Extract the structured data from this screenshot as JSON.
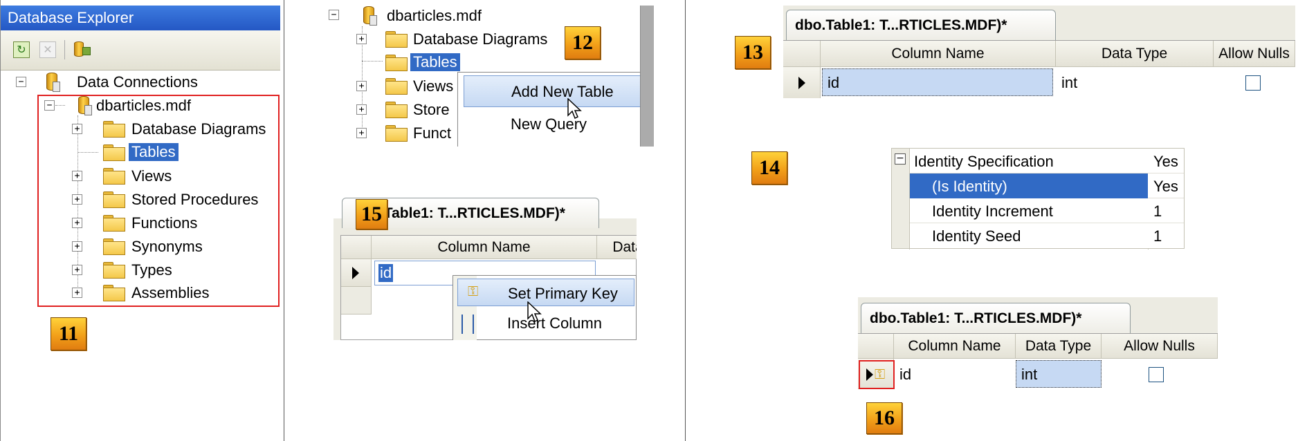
{
  "panel11": {
    "title": "Database Explorer",
    "step": "11",
    "root": "Data Connections",
    "db": "dbarticles.mdf",
    "items": [
      "Database Diagrams",
      "Tables",
      "Views",
      "Stored Procedures",
      "Functions",
      "Synonyms",
      "Types",
      "Assemblies"
    ]
  },
  "panel12": {
    "step": "12",
    "db": "dbarticles.mdf",
    "items": [
      "Database Diagrams",
      "Tables",
      "Views",
      "Store",
      "Funct"
    ],
    "menu": [
      "Add New Table",
      "New Query"
    ]
  },
  "panel13": {
    "step": "13",
    "tab": "dbo.Table1: T...RTICLES.MDF)*",
    "headers": [
      "Column Name",
      "Data Type",
      "Allow Nulls"
    ],
    "row": {
      "name": "id",
      "type": "int"
    }
  },
  "panel14": {
    "step": "14",
    "rows": [
      {
        "label": "Identity Specification",
        "value": "Yes"
      },
      {
        "label": "(Is Identity)",
        "value": "Yes"
      },
      {
        "label": "Identity Increment",
        "value": "1"
      },
      {
        "label": "Identity Seed",
        "value": "1"
      }
    ]
  },
  "panel15": {
    "step": "15",
    "tab": ".Table1: T...RTICLES.MDF)*",
    "headers": [
      "Column Name",
      "Data"
    ],
    "row": {
      "name": "id"
    },
    "menu": [
      "Set Primary Key",
      "Insert Column"
    ]
  },
  "panel16": {
    "step": "16",
    "tab": "dbo.Table1: T...RTICLES.MDF)*",
    "headers": [
      "Column Name",
      "Data Type",
      "Allow Nulls"
    ],
    "row": {
      "name": "id",
      "type": "int"
    }
  },
  "colors": {
    "accent": "#316ac5",
    "step_badge": "#f2a019",
    "highlight_border": "#e02020"
  }
}
